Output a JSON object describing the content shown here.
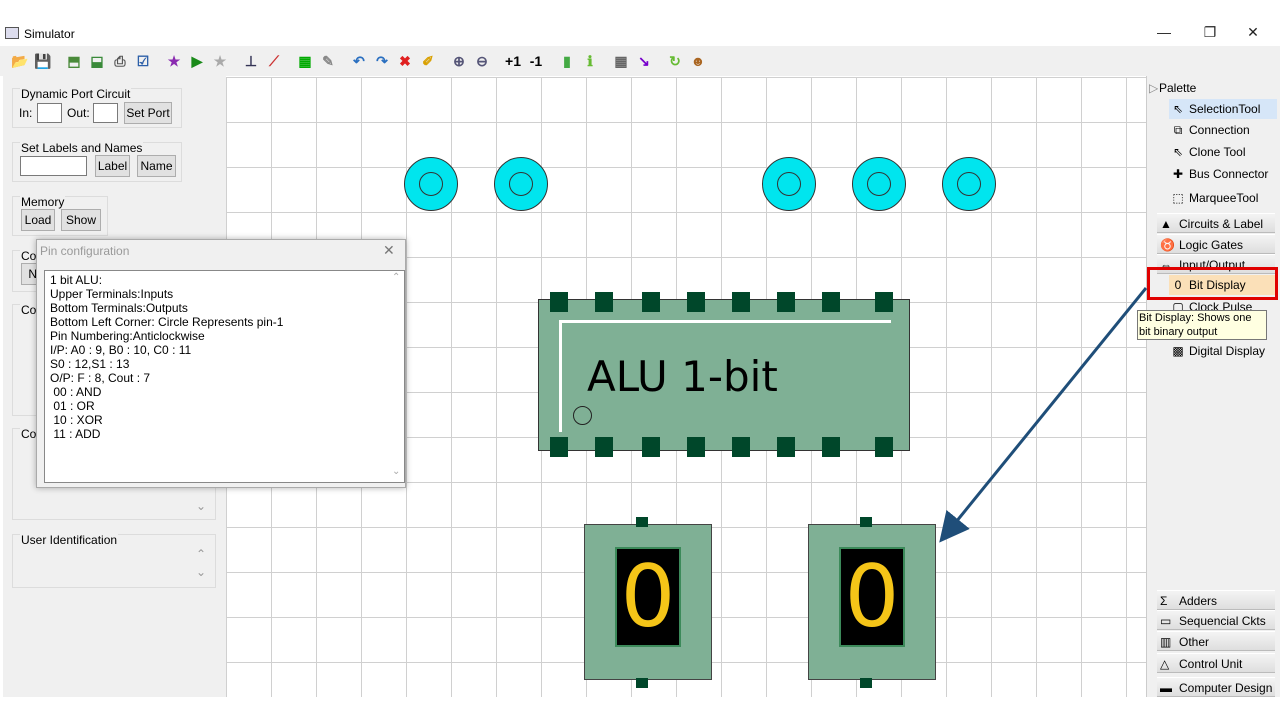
{
  "window": {
    "title": "Simulator",
    "minimize": "—",
    "restore": "❐",
    "close": "✕"
  },
  "toolbar": {
    "icons": [
      "open-icon",
      "save-icon",
      "export-icon",
      "clone-icon",
      "print-icon",
      "verify-icon",
      "star-icon",
      "play-icon",
      "star-disabled-icon",
      "wire-icon",
      "wire-diag-icon",
      "timing-icon",
      "edit-icon",
      "undo-icon",
      "redo-icon",
      "delete-icon",
      "clean-icon",
      "zoom-in-icon",
      "zoom-out-icon",
      "plus-one-icon",
      "minus-one-icon",
      "chip-icon",
      "info-icon",
      "grid-icon",
      "route-icon",
      "refresh-icon",
      "users-icon"
    ],
    "plus_one": "+1",
    "minus_one": "-1"
  },
  "left": {
    "dynamic_port": {
      "title": "Dynamic Port Circuit",
      "in_label": "In:",
      "in_value": "",
      "out_label": "Out:",
      "out_value": "",
      "set_port": "Set Port"
    },
    "labels": {
      "title": "Set Labels and Names",
      "value": "",
      "label_btn": "Label",
      "name_btn": "Name"
    },
    "memory": {
      "title": "Memory",
      "load": "Load",
      "show": "Show"
    },
    "hidden_groups": [
      "Co",
      "Ne",
      "Co",
      "Co"
    ],
    "user_identification": {
      "title": "User Identification"
    }
  },
  "dialog": {
    "title": "Pin configuration",
    "close": "✕",
    "lines": [
      "1 bit ALU:",
      "Upper Terminals:Inputs",
      "Bottom Terminals:Outputs",
      "Bottom Left Corner: Circle Represents pin-1",
      "Pin Numbering:Anticlockwise",
      "I/P: A0 : 9, B0 : 10, C0 : 11",
      "S0 : 12,S1 : 13",
      "O/P: F : 8, Cout : 7",
      " 00 : AND",
      " 01 : OR",
      " 10 : XOR",
      " 11 : ADD"
    ]
  },
  "canvas": {
    "alu_label": "ALU 1-bit",
    "bit_displays": [
      "0",
      "0"
    ],
    "colors": {
      "led": "#00e5ee",
      "chip": "#7fb095",
      "pin": "#00472a",
      "digit": "#f5c518",
      "highlight": "#e00000",
      "arrow": "#1f4e79"
    }
  },
  "palette": {
    "title": "Palette",
    "tools": [
      {
        "label": "SelectionTool",
        "icon": "cursor-icon",
        "selected": true
      },
      {
        "label": "Connection",
        "icon": "connection-icon"
      },
      {
        "label": "Clone Tool",
        "icon": "clone-cursor-icon"
      },
      {
        "label": "Bus Connector",
        "icon": "bus-icon"
      },
      {
        "label": "MarqueeTool",
        "icon": "marquee-icon"
      }
    ],
    "drawers_top": [
      {
        "label": "Circuits & Label",
        "icon": "circuits-icon"
      },
      {
        "label": "Logic Gates",
        "icon": "gates-icon"
      },
      {
        "label": "Input/Output",
        "icon": "io-icon"
      }
    ],
    "io_items": [
      {
        "label": "Bit Display",
        "icon": "bit-display-icon",
        "highlighted": true
      },
      {
        "label": "Clock Pulse",
        "icon": "clock-icon"
      },
      {
        "label": "Digital Display",
        "icon": "digital-display-icon"
      }
    ],
    "tooltip": "Bit Display: Shows one bit binary output",
    "drawers_bottom": [
      {
        "label": "Adders",
        "icon": "sigma-icon"
      },
      {
        "label": "Sequencial Ckts",
        "icon": "sequential-icon"
      },
      {
        "label": "Other Components",
        "icon": "components-icon"
      },
      {
        "label": "Control Unit",
        "icon": "control-unit-icon"
      },
      {
        "label": "Computer Design",
        "icon": "computer-icon"
      }
    ]
  }
}
